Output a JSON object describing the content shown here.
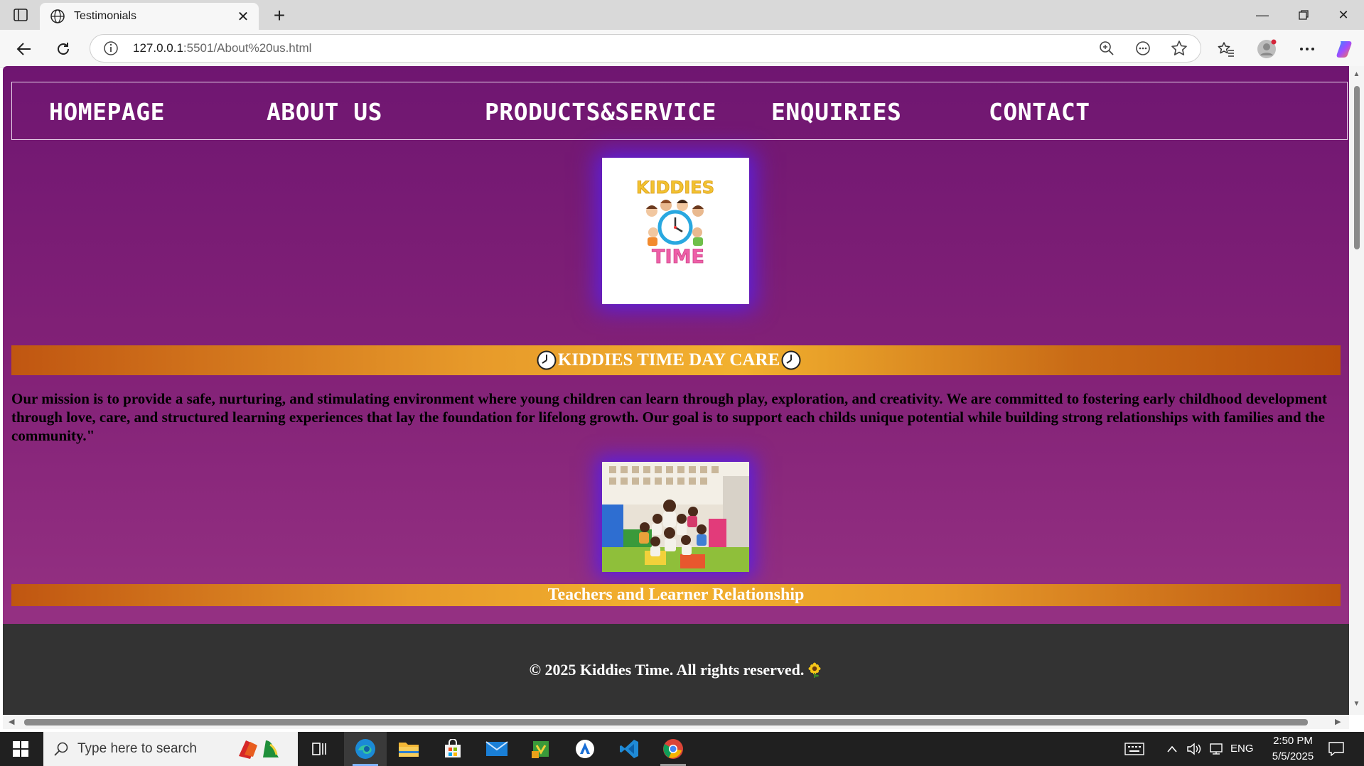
{
  "browser": {
    "tab_title": "Testimonials",
    "url_host": "127.0.0.1",
    "url_rest": ":5501/About%20us.html"
  },
  "nav": {
    "items": [
      "HOMEPAGE",
      "ABOUT US",
      "PRODUCTS&SERVICE",
      "ENQUIRIES",
      "CONTACT"
    ]
  },
  "logo": {
    "line1": "KIDDIES",
    "line2": "TIME"
  },
  "heading": {
    "title": "KIDDIES TIME DAY CARE"
  },
  "mission": {
    "text": "Our mission is to provide a safe, nurturing, and stimulating environment where young children can learn through play, exploration, and creativity. We are committed to fostering early childhood development through love, care, and structured learning experiences that lay the foundation for lifelong growth. Our goal is to support each childs unique potential while building strong relationships with families and the community.\""
  },
  "photo": {
    "caption": "Teachers and Learner Relationship"
  },
  "footer": {
    "text": "© 2025 Kiddies Time. All rights reserved."
  },
  "taskbar": {
    "search_placeholder": "Type here to search",
    "language": "ENG",
    "time": "2:50 PM",
    "date": "5/5/2025"
  },
  "colors": {
    "page_top": "#6f1671",
    "page_bottom": "#9b3686",
    "band_orange": "#e79a2a",
    "footer_bg": "#333333",
    "glow": "#5b1fe0"
  },
  "icons": [
    "sidebar-toggle-icon",
    "globe-icon",
    "close-icon",
    "plus-icon",
    "back-icon",
    "reload-icon",
    "info-icon",
    "zoom-icon",
    "reader-icon",
    "star-icon",
    "favorites-icon",
    "profile-icon",
    "more-icon",
    "copilot-icon",
    "clock-icon",
    "sunflower-icon",
    "windows-icon",
    "search-icon"
  ]
}
